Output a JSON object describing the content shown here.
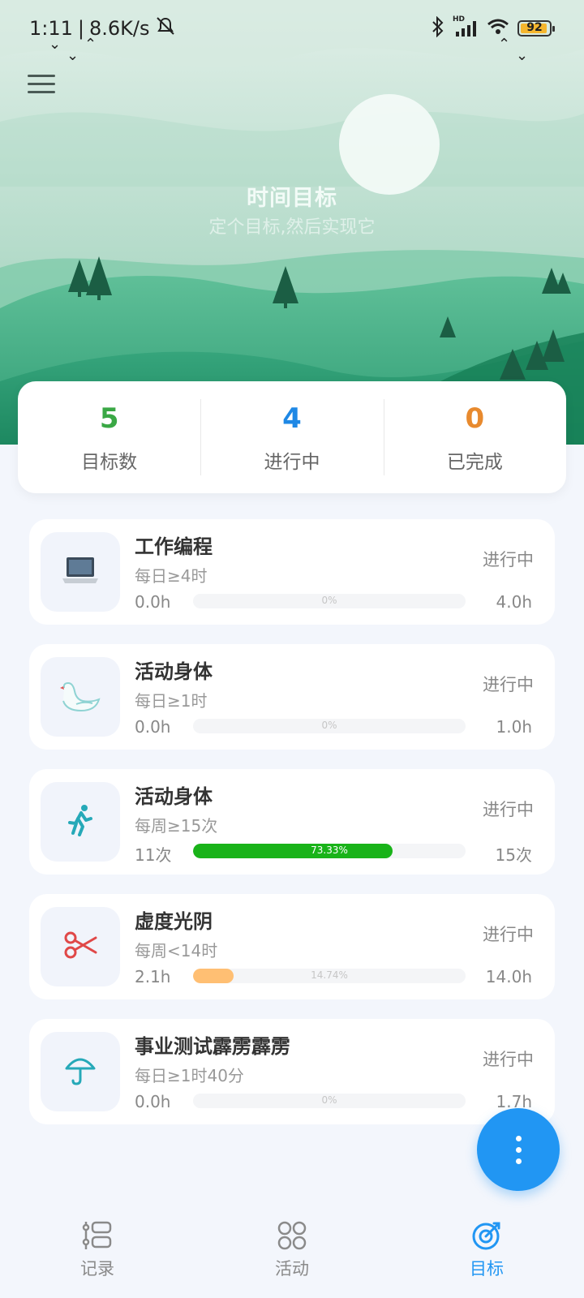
{
  "status_bar": {
    "time": "1:11",
    "net_speed": "8.6K/s",
    "signal": "HD",
    "battery": "92"
  },
  "hero": {
    "title": "时间目标",
    "subtitle": "定个目标,然后实现它"
  },
  "stats": [
    {
      "value": "5",
      "label": "目标数",
      "color": "#3aa845"
    },
    {
      "value": "4",
      "label": "进行中",
      "color": "#1e88e5"
    },
    {
      "value": "0",
      "label": "已完成",
      "color": "#e88a2e"
    }
  ],
  "goals": [
    {
      "name": "工作编程",
      "rule": "每日≥4时",
      "status": "进行中",
      "current": "0.0h",
      "target": "4.0h",
      "progress_label": "0%",
      "progress": 0,
      "bar_color": "#e0e0e0",
      "icon": "laptop-icon"
    },
    {
      "name": "活动身体",
      "rule": "每日≥1时",
      "status": "进行中",
      "current": "0.0h",
      "target": "1.0h",
      "progress_label": "0%",
      "progress": 0,
      "bar_color": "#e0e0e0",
      "icon": "swan-icon"
    },
    {
      "name": "活动身体",
      "rule": "每周≥15次",
      "status": "进行中",
      "current": "11次",
      "target": "15次",
      "progress_label": "73.33%",
      "progress": 0.7333,
      "bar_color": "#19b319",
      "icon": "runner-icon"
    },
    {
      "name": "虚度光阴",
      "rule": "每周<14时",
      "status": "进行中",
      "current": "2.1h",
      "target": "14.0h",
      "progress_label": "14.74%",
      "progress": 0.1474,
      "bar_color": "#ffbf73",
      "icon": "scissors-icon"
    },
    {
      "name": "事业测试霹雳霹雳",
      "rule": "每日≥1时40分",
      "status": "进行中",
      "current": "0.0h",
      "target": "1.7h",
      "progress_label": "0%",
      "progress": 0,
      "bar_color": "#e0e0e0",
      "icon": "umbrella-icon"
    }
  ],
  "tabs": [
    {
      "label": "记录",
      "icon": "record-list-icon",
      "active": false
    },
    {
      "label": "活动",
      "icon": "activity-grid-icon",
      "active": false
    },
    {
      "label": "目标",
      "icon": "target-icon",
      "active": true
    }
  ],
  "colors": {
    "accent": "#2196f3",
    "hero_green": "#3fae86",
    "page_bg": "#f3f6fc"
  }
}
